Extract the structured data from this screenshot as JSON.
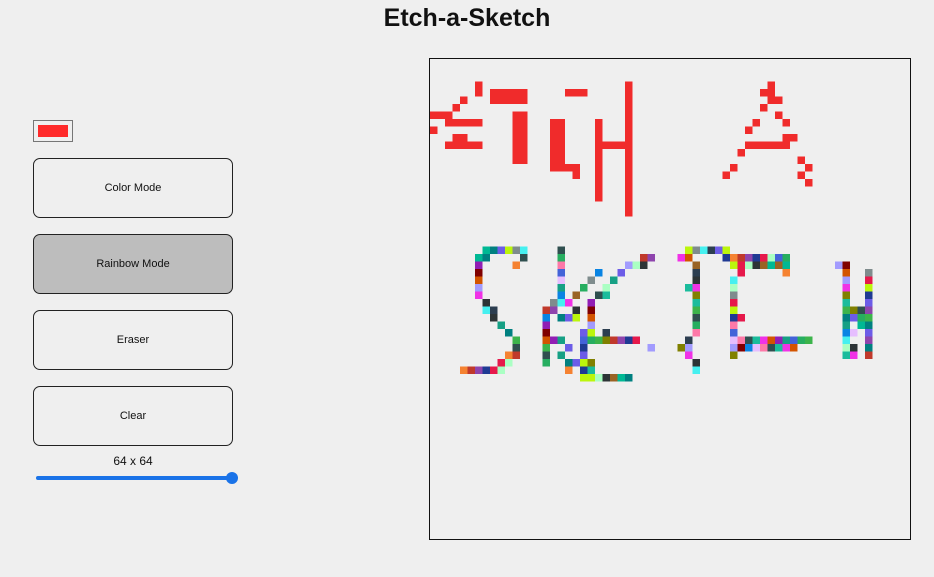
{
  "app": {
    "title": "Etch-a-Sketch"
  },
  "colorPicker": {
    "value": "#ff2a2a",
    "icon": "color-swatch"
  },
  "buttons": {
    "color_mode": "Color Mode",
    "rainbow_mode": "Rainbow Mode",
    "eraser": "Eraser",
    "clear": "Clear"
  },
  "activeMode": "rainbow_mode",
  "grid": {
    "size_label": "64 x 64",
    "size": 64,
    "slider_min": 1,
    "slider_max": 64,
    "background": "#efefef",
    "colors": {
      "red": "#f02b2b",
      "rainbow": [
        "#e6194b",
        "#3cb44b",
        "#8e44ad",
        "#4363d8",
        "#f58231",
        "#911eb4",
        "#46f0f0",
        "#f032e6",
        "#bcf60c",
        "#2f4f4f",
        "#008080",
        "#e6beff",
        "#9a6324",
        "#800000",
        "#aaffc3",
        "#808000",
        "#1f3a93",
        "#27ae60",
        "#c0392b",
        "#16a085",
        "#2c3e50",
        "#d35400",
        "#7f8c8d",
        "#1abc9c",
        "#6c5ce7",
        "#fd79a8",
        "#00b894",
        "#0984e3",
        "#2d3436",
        "#a29bfe"
      ]
    },
    "paint": [
      {
        "c": "red",
        "r": [
          [
            3,
            6,
            7
          ],
          [
            4,
            6,
            7
          ],
          [
            5,
            4,
            5
          ],
          [
            6,
            3,
            4
          ],
          [
            7,
            2,
            3
          ],
          [
            7,
            0,
            2
          ],
          [
            8,
            2,
            7
          ],
          [
            9,
            0,
            1
          ],
          [
            10,
            3,
            5
          ],
          [
            11,
            2,
            7
          ],
          [
            7,
            11,
            13
          ],
          [
            8,
            11,
            13
          ],
          [
            9,
            11,
            13
          ],
          [
            10,
            11,
            13
          ],
          [
            11,
            11,
            13
          ],
          [
            12,
            11,
            13
          ],
          [
            13,
            11,
            13
          ],
          [
            4,
            8,
            13
          ],
          [
            5,
            8,
            13
          ],
          [
            8,
            16,
            18
          ],
          [
            9,
            16,
            18
          ],
          [
            10,
            16,
            18
          ],
          [
            11,
            16,
            18
          ],
          [
            12,
            16,
            18
          ],
          [
            13,
            16,
            18
          ],
          [
            14,
            16,
            18
          ],
          [
            4,
            18,
            21
          ],
          [
            14,
            18,
            20
          ],
          [
            15,
            19,
            20
          ],
          [
            3,
            26,
            27
          ],
          [
            4,
            26,
            27
          ],
          [
            5,
            26,
            27
          ],
          [
            6,
            26,
            27
          ],
          [
            7,
            26,
            27
          ],
          [
            8,
            26,
            27
          ],
          [
            9,
            26,
            27
          ],
          [
            10,
            26,
            27
          ],
          [
            11,
            26,
            27
          ],
          [
            12,
            26,
            27
          ],
          [
            13,
            26,
            27
          ],
          [
            14,
            26,
            27
          ],
          [
            15,
            26,
            27
          ],
          [
            16,
            26,
            27
          ],
          [
            17,
            26,
            27
          ],
          [
            18,
            26,
            27
          ],
          [
            19,
            26,
            27
          ],
          [
            20,
            26,
            27
          ],
          [
            8,
            22,
            23
          ],
          [
            9,
            22,
            23
          ],
          [
            10,
            22,
            23
          ],
          [
            11,
            22,
            23
          ],
          [
            12,
            22,
            23
          ],
          [
            13,
            22,
            23
          ],
          [
            14,
            22,
            23
          ],
          [
            15,
            22,
            23
          ],
          [
            16,
            22,
            23
          ],
          [
            17,
            22,
            23
          ],
          [
            18,
            22,
            23
          ],
          [
            11,
            23,
            27
          ],
          [
            3,
            45,
            46
          ],
          [
            4,
            44,
            46
          ],
          [
            5,
            45,
            47
          ],
          [
            6,
            44,
            45
          ],
          [
            7,
            46,
            47
          ],
          [
            8,
            43,
            44
          ],
          [
            8,
            47,
            48
          ],
          [
            9,
            42,
            43
          ],
          [
            10,
            47,
            49
          ],
          [
            11,
            42,
            44
          ],
          [
            11,
            44,
            48
          ],
          [
            12,
            41,
            42
          ],
          [
            13,
            49,
            50
          ],
          [
            14,
            40,
            41
          ],
          [
            14,
            50,
            51
          ],
          [
            15,
            39,
            40
          ],
          [
            15,
            49,
            50
          ],
          [
            16,
            50,
            51
          ]
        ]
      },
      {
        "c": "rainbow",
        "r": [
          [
            25,
            7,
            13
          ],
          [
            26,
            6,
            8
          ],
          [
            27,
            6,
            7
          ],
          [
            28,
            6,
            7
          ],
          [
            29,
            6,
            7
          ],
          [
            30,
            6,
            7
          ],
          [
            31,
            6,
            7
          ],
          [
            32,
            7,
            8
          ],
          [
            33,
            7,
            9
          ],
          [
            34,
            8,
            9
          ],
          [
            35,
            9,
            10
          ],
          [
            36,
            10,
            11
          ],
          [
            37,
            11,
            12
          ],
          [
            38,
            11,
            12
          ],
          [
            39,
            10,
            12
          ],
          [
            40,
            9,
            11
          ],
          [
            41,
            4,
            10
          ],
          [
            26,
            12,
            13
          ],
          [
            27,
            11,
            12
          ],
          [
            25,
            17,
            18
          ],
          [
            26,
            17,
            18
          ],
          [
            27,
            17,
            18
          ],
          [
            28,
            17,
            18
          ],
          [
            29,
            17,
            18
          ],
          [
            30,
            17,
            18
          ],
          [
            31,
            17,
            18
          ],
          [
            32,
            16,
            18
          ],
          [
            33,
            15,
            17
          ],
          [
            34,
            15,
            16
          ],
          [
            35,
            15,
            16
          ],
          [
            36,
            15,
            16
          ],
          [
            37,
            15,
            18
          ],
          [
            38,
            15,
            16
          ],
          [
            39,
            15,
            16
          ],
          [
            40,
            15,
            16
          ],
          [
            41,
            18,
            19
          ],
          [
            42,
            20,
            21
          ],
          [
            28,
            22,
            23
          ],
          [
            29,
            21,
            22
          ],
          [
            30,
            20,
            21
          ],
          [
            31,
            19,
            20
          ],
          [
            32,
            18,
            19
          ],
          [
            33,
            19,
            20
          ],
          [
            34,
            17,
            20
          ],
          [
            38,
            18,
            19
          ],
          [
            39,
            17,
            18
          ],
          [
            40,
            18,
            21
          ],
          [
            41,
            20,
            22
          ],
          [
            42,
            21,
            22
          ],
          [
            27,
            26,
            27
          ],
          [
            28,
            25,
            26
          ],
          [
            29,
            24,
            25
          ],
          [
            30,
            23,
            24
          ],
          [
            31,
            22,
            24
          ],
          [
            32,
            21,
            22
          ],
          [
            33,
            21,
            22
          ],
          [
            34,
            21,
            22
          ],
          [
            35,
            21,
            22
          ],
          [
            36,
            20,
            22
          ],
          [
            37,
            20,
            26
          ],
          [
            38,
            20,
            21
          ],
          [
            39,
            20,
            21
          ],
          [
            40,
            21,
            22
          ],
          [
            41,
            21,
            22
          ],
          [
            42,
            22,
            27
          ],
          [
            36,
            23,
            24
          ],
          [
            37,
            25,
            27
          ],
          [
            26,
            28,
            30
          ],
          [
            27,
            27,
            29
          ],
          [
            38,
            29,
            30
          ],
          [
            37,
            24,
            28
          ],
          [
            25,
            34,
            39
          ],
          [
            26,
            33,
            35
          ],
          [
            27,
            35,
            36
          ],
          [
            28,
            35,
            36
          ],
          [
            29,
            35,
            36
          ],
          [
            30,
            34,
            36
          ],
          [
            31,
            35,
            36
          ],
          [
            32,
            35,
            36
          ],
          [
            33,
            35,
            36
          ],
          [
            34,
            35,
            36
          ],
          [
            35,
            35,
            36
          ],
          [
            36,
            35,
            36
          ],
          [
            37,
            34,
            35
          ],
          [
            38,
            33,
            35
          ],
          [
            39,
            34,
            35
          ],
          [
            40,
            35,
            36
          ],
          [
            41,
            35,
            36
          ],
          [
            25,
            38,
            40
          ],
          [
            26,
            39,
            41
          ],
          [
            27,
            40,
            42
          ],
          [
            28,
            41,
            42
          ],
          [
            26,
            40,
            46
          ],
          [
            27,
            41,
            46
          ],
          [
            29,
            40,
            41
          ],
          [
            30,
            40,
            41
          ],
          [
            31,
            40,
            41
          ],
          [
            32,
            40,
            41
          ],
          [
            33,
            40,
            41
          ],
          [
            34,
            40,
            42
          ],
          [
            35,
            40,
            41
          ],
          [
            36,
            40,
            41
          ],
          [
            37,
            40,
            51
          ],
          [
            38,
            40,
            49
          ],
          [
            39,
            40,
            41
          ],
          [
            26,
            46,
            48
          ],
          [
            27,
            46,
            48
          ],
          [
            28,
            47,
            48
          ],
          [
            27,
            54,
            56
          ],
          [
            28,
            55,
            56
          ],
          [
            29,
            55,
            56
          ],
          [
            30,
            55,
            56
          ],
          [
            31,
            55,
            56
          ],
          [
            32,
            55,
            56
          ],
          [
            33,
            55,
            57
          ],
          [
            34,
            55,
            57
          ],
          [
            35,
            55,
            56
          ],
          [
            36,
            55,
            57
          ],
          [
            37,
            55,
            56
          ],
          [
            38,
            55,
            57
          ],
          [
            39,
            55,
            57
          ],
          [
            33,
            57,
            58
          ],
          [
            34,
            57,
            59
          ],
          [
            35,
            57,
            59
          ],
          [
            28,
            58,
            59
          ],
          [
            29,
            58,
            59
          ],
          [
            30,
            58,
            59
          ],
          [
            31,
            58,
            59
          ],
          [
            32,
            58,
            59
          ],
          [
            33,
            58,
            59
          ],
          [
            36,
            58,
            59
          ],
          [
            37,
            58,
            59
          ],
          [
            38,
            58,
            59
          ],
          [
            39,
            58,
            59
          ]
        ]
      }
    ]
  }
}
